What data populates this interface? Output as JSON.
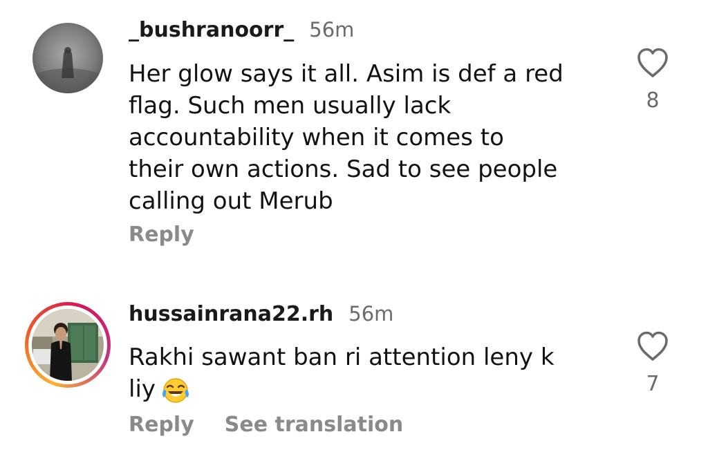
{
  "comments": [
    {
      "username": "_bushranoorr_",
      "time": "56m",
      "text": "Her glow says it all. Asim is def a red\nflag. Such men usually lack\naccountability when it comes to\ntheir own actions. Sad to see people\ncalling out Merub",
      "like_count": "8",
      "actions": [
        "Reply"
      ],
      "avatar_icon": "grey-misty-figure-avatar",
      "story_ring": false
    },
    {
      "username": "hussainrana22.rh",
      "time": "56m",
      "text": "Rakhi sawant ban ri attention leny k\nliy",
      "emoji": "😂",
      "emoji_icon": "face-with-tears-of-joy-icon",
      "like_count": "7",
      "actions": [
        "Reply",
        "See translation"
      ],
      "avatar_icon": "man-in-courtyard-avatar",
      "story_ring": true
    }
  ],
  "colors": {
    "text": "#121212",
    "secondary": "#6b6b6b",
    "action": "#8a8a8a",
    "ring_start": "#f9b233",
    "ring_end": "#c13584"
  }
}
